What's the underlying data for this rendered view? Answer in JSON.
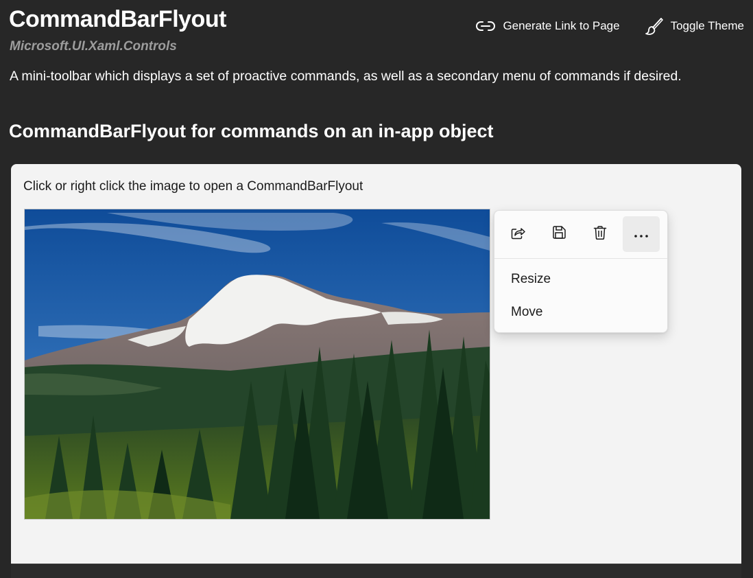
{
  "header": {
    "title": "CommandBarFlyout",
    "namespace": "Microsoft.UI.Xaml.Controls",
    "description": "A mini-toolbar which displays a set of proactive commands, as well as a secondary menu of commands if desired.",
    "actions": [
      {
        "label": "Generate Link to Page",
        "icon": "link-icon"
      },
      {
        "label": "Toggle Theme",
        "icon": "paintbrush-icon"
      }
    ]
  },
  "section": {
    "heading": "CommandBarFlyout for commands on an in-app object"
  },
  "example": {
    "instructions": "Click or right click the image to open a CommandBarFlyout",
    "image_subject": "mountain-landscape",
    "flyout": {
      "primary_commands": [
        {
          "name": "share",
          "icon": "share-icon"
        },
        {
          "name": "save",
          "icon": "save-icon"
        },
        {
          "name": "delete",
          "icon": "delete-icon"
        },
        {
          "name": "more",
          "icon": "more-icon"
        }
      ],
      "secondary_commands": [
        {
          "label": "Resize"
        },
        {
          "label": "Move"
        }
      ]
    }
  },
  "colors": {
    "page_background": "#272727",
    "card_background": "#f3f3f3",
    "namespace_text": "#9d9d9d",
    "flyout_background": "#fbfbfb"
  }
}
